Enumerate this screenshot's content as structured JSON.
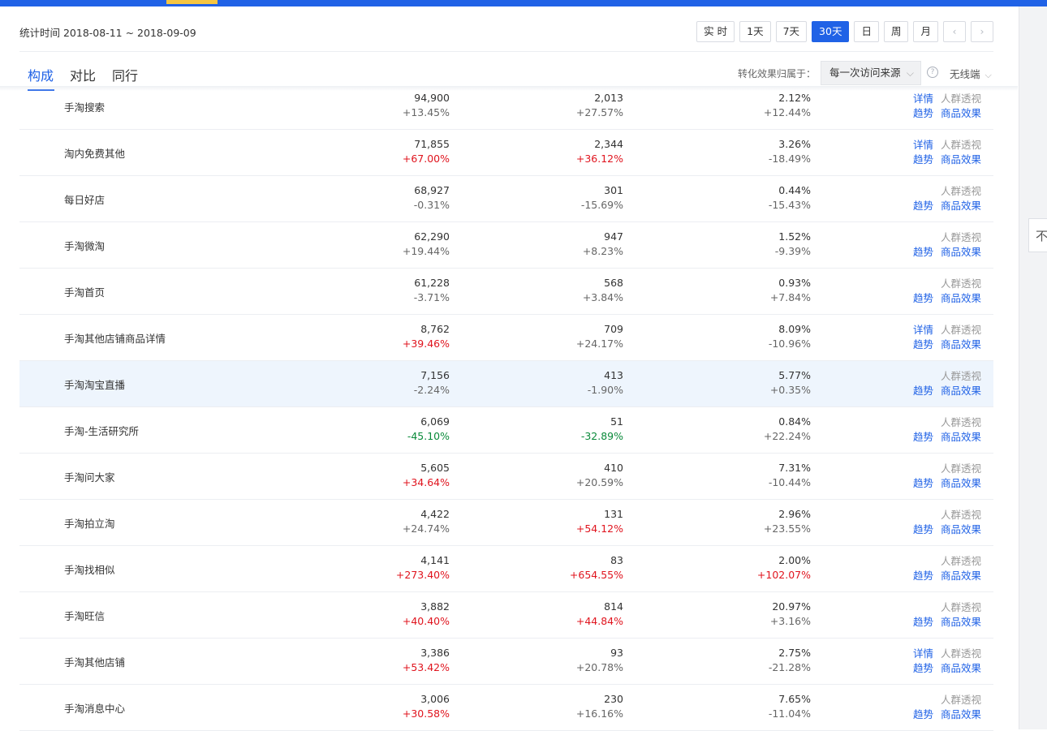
{
  "header": {
    "date_range": "统计时间 2018-08-11 ~ 2018-09-09",
    "buttons": [
      "实 时",
      "1天",
      "7天",
      "30天",
      "日",
      "周",
      "月"
    ],
    "active_button": "30天",
    "prev_arrow": "‹",
    "next_arrow": "›"
  },
  "tabs": {
    "items": [
      "构成",
      "对比",
      "同行"
    ],
    "active": "构成"
  },
  "attribution": {
    "label": "转化效果归属于：",
    "source_value": "每一次访问来源",
    "device_value": "无线端"
  },
  "side_tab": {
    "label": "不"
  },
  "rows": [
    {
      "name": "手淘搜索",
      "v1": "94,900",
      "c1": "+13.45%",
      "t1": "neutral",
      "v2": "2,013",
      "c2": "+27.57%",
      "t2": "neutral",
      "v3": "2.12%",
      "c3": "+12.44%",
      "t3": "neutral",
      "has_detail": true
    },
    {
      "name": "淘内免费其他",
      "v1": "71,855",
      "c1": "+67.00%",
      "t1": "up",
      "v2": "2,344",
      "c2": "+36.12%",
      "t2": "up",
      "v3": "3.26%",
      "c3": "-18.49%",
      "t3": "neutral",
      "has_detail": true
    },
    {
      "name": "每日好店",
      "v1": "68,927",
      "c1": "-0.31%",
      "t1": "neutral",
      "v2": "301",
      "c2": "-15.69%",
      "t2": "neutral",
      "v3": "0.44%",
      "c3": "-15.43%",
      "t3": "neutral",
      "has_detail": false
    },
    {
      "name": "手淘微淘",
      "v1": "62,290",
      "c1": "+19.44%",
      "t1": "neutral",
      "v2": "947",
      "c2": "+8.23%",
      "t2": "neutral",
      "v3": "1.52%",
      "c3": "-9.39%",
      "t3": "neutral",
      "has_detail": false
    },
    {
      "name": "手淘首页",
      "v1": "61,228",
      "c1": "-3.71%",
      "t1": "neutral",
      "v2": "568",
      "c2": "+3.84%",
      "t2": "neutral",
      "v3": "0.93%",
      "c3": "+7.84%",
      "t3": "neutral",
      "has_detail": false
    },
    {
      "name": "手淘其他店铺商品详情",
      "v1": "8,762",
      "c1": "+39.46%",
      "t1": "up",
      "v2": "709",
      "c2": "+24.17%",
      "t2": "neutral",
      "v3": "8.09%",
      "c3": "-10.96%",
      "t3": "neutral",
      "has_detail": true
    },
    {
      "name": "手淘淘宝直播",
      "v1": "7,156",
      "c1": "-2.24%",
      "t1": "neutral",
      "v2": "413",
      "c2": "-1.90%",
      "t2": "neutral",
      "v3": "5.77%",
      "c3": "+0.35%",
      "t3": "neutral",
      "has_detail": false,
      "highlight": true
    },
    {
      "name": "手淘-生活研究所",
      "v1": "6,069",
      "c1": "-45.10%",
      "t1": "down",
      "v2": "51",
      "c2": "-32.89%",
      "t2": "down",
      "v3": "0.84%",
      "c3": "+22.24%",
      "t3": "neutral",
      "has_detail": false
    },
    {
      "name": "手淘问大家",
      "v1": "5,605",
      "c1": "+34.64%",
      "t1": "up",
      "v2": "410",
      "c2": "+20.59%",
      "t2": "neutral",
      "v3": "7.31%",
      "c3": "-10.44%",
      "t3": "neutral",
      "has_detail": false
    },
    {
      "name": "手淘拍立淘",
      "v1": "4,422",
      "c1": "+24.74%",
      "t1": "neutral",
      "v2": "131",
      "c2": "+54.12%",
      "t2": "up",
      "v3": "2.96%",
      "c3": "+23.55%",
      "t3": "neutral",
      "has_detail": false
    },
    {
      "name": "手淘找相似",
      "v1": "4,141",
      "c1": "+273.40%",
      "t1": "up",
      "v2": "83",
      "c2": "+654.55%",
      "t2": "up",
      "v3": "2.00%",
      "c3": "+102.07%",
      "t3": "up",
      "has_detail": false
    },
    {
      "name": "手淘旺信",
      "v1": "3,882",
      "c1": "+40.40%",
      "t1": "up",
      "v2": "814",
      "c2": "+44.84%",
      "t2": "up",
      "v3": "20.97%",
      "c3": "+3.16%",
      "t3": "neutral",
      "has_detail": false
    },
    {
      "name": "手淘其他店铺",
      "v1": "3,386",
      "c1": "+53.42%",
      "t1": "up",
      "v2": "93",
      "c2": "+20.78%",
      "t2": "neutral",
      "v3": "2.75%",
      "c3": "-21.28%",
      "t3": "neutral",
      "has_detail": true
    },
    {
      "name": "手淘消息中心",
      "v1": "3,006",
      "c1": "+30.58%",
      "t1": "up",
      "v2": "230",
      "c2": "+16.16%",
      "t2": "neutral",
      "v3": "7.65%",
      "c3": "-11.04%",
      "t3": "neutral",
      "has_detail": false
    }
  ],
  "row_links": {
    "detail": "详情",
    "crowd": "人群透视",
    "trend": "趋势",
    "product": "商品效果"
  },
  "colors": {
    "accent": "#2062e6",
    "increase": "#e0141e",
    "decrease": "#0a8a3a"
  }
}
